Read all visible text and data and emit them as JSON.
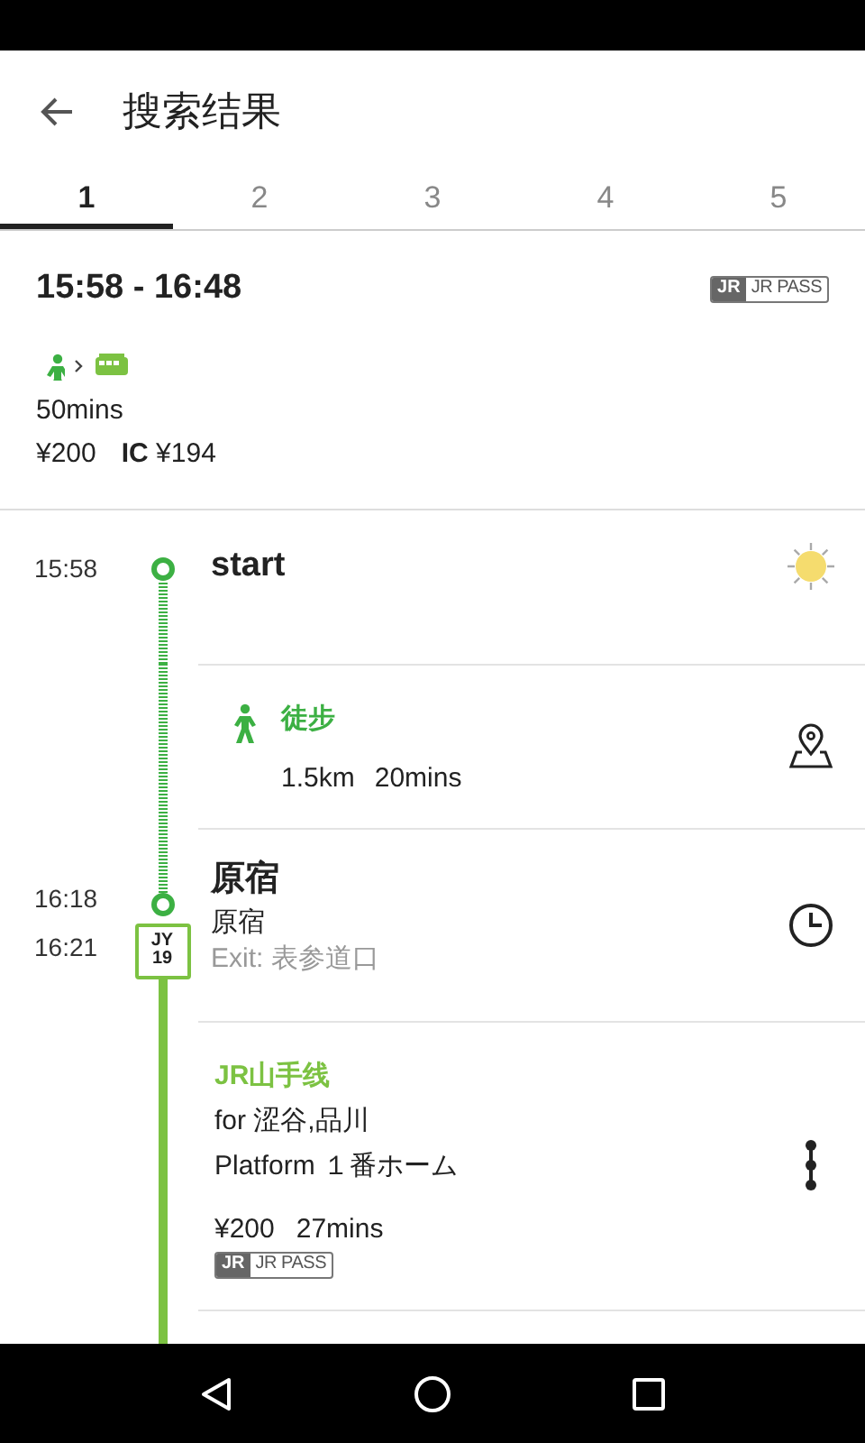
{
  "header": {
    "title": "搜索结果"
  },
  "tabs": [
    {
      "label": "1",
      "selected": true
    },
    {
      "label": "2",
      "selected": false
    },
    {
      "label": "3",
      "selected": false
    },
    {
      "label": "4",
      "selected": false
    },
    {
      "label": "5",
      "selected": false
    }
  ],
  "summary": {
    "time_range": "15:58 - 16:48",
    "badge": {
      "logo": "JR",
      "label": "JR PASS"
    },
    "modes": [
      {
        "kind": "walk"
      },
      {
        "kind": "train"
      }
    ],
    "duration": "50mins",
    "fare": "¥200",
    "ic_fare": "**IC** ¥194"
  },
  "legs": [
    {
      "kind": "start",
      "times": [
        "15:58"
      ],
      "name": "start"
    },
    {
      "kind": "walk",
      "color": "#3cb043",
      "title": "徒步",
      "details": [
        "1.5km",
        "20mins"
      ]
    },
    {
      "kind": "station",
      "times": [
        "16:18",
        "16:21"
      ],
      "name": "原宿",
      "platform_code": [
        "JY",
        "19"
      ],
      "subtitle": "原宿",
      "exit": "Exit: 表参道口"
    },
    {
      "kind": "train",
      "color": "#7cc242",
      "title": "JR山手线",
      "direction": "for 涩谷,品川",
      "platform": "Platform １番ホーム",
      "details": [
        "¥200",
        "27mins"
      ],
      "badge": {
        "logo": "JR",
        "label": "JR PASS"
      }
    }
  ]
}
